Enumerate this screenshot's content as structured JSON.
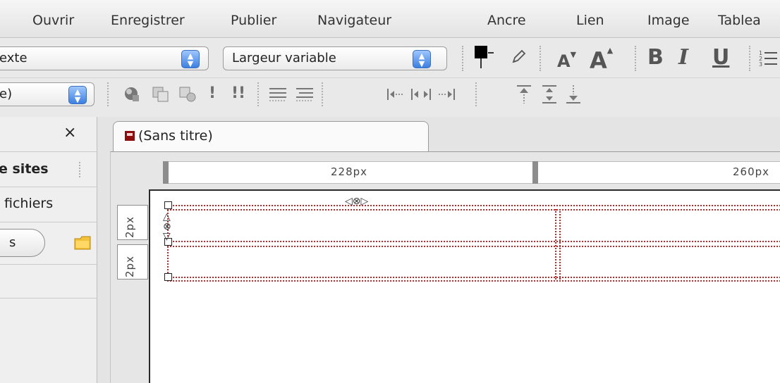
{
  "main_toolbar": {
    "items": [
      "Ouvrir",
      "Enregistrer",
      "Publier",
      "Navigateur",
      "Ancre",
      "Lien",
      "Image",
      "Tablea"
    ]
  },
  "format_toolbar": {
    "paragraph_style": "exte",
    "width_mode": "Largeur variable",
    "text_color": "#000000",
    "bold_label": "B",
    "italic_label": "I",
    "underline_label": "U",
    "font_size_small_label": "A",
    "font_size_large_label": "A",
    "class_select": "e)",
    "exclaim_single": "!",
    "exclaim_double": "!!"
  },
  "left_panel": {
    "close_label": "×",
    "sites_label": "e sites",
    "files_label": "fichiers",
    "pill_label": "s"
  },
  "document": {
    "tab_title": "(Sans titre)",
    "ruler_col1": "228px",
    "ruler_col2": "260px",
    "ruler_row1": "2px",
    "ruler_row2": "2px"
  },
  "colors": {
    "cell_border": "#c0292b",
    "accent_stepper": "#3c7fe0"
  }
}
